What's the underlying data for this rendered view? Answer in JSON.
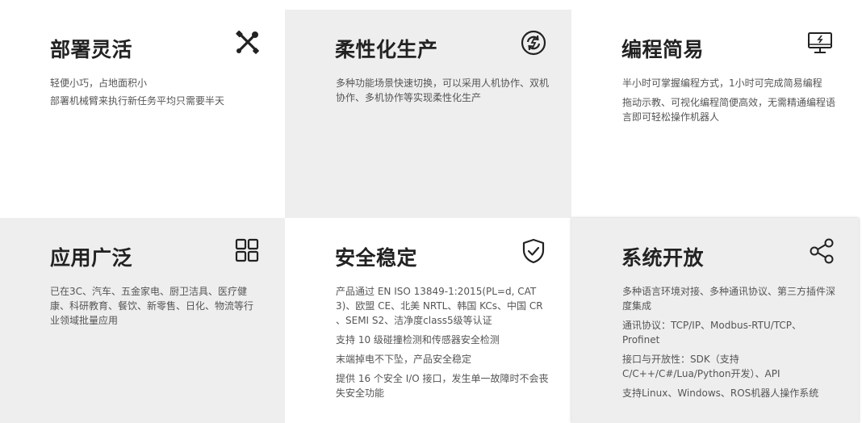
{
  "cards": [
    {
      "title": "部署灵活",
      "icon": "tools-icon",
      "lines": [
        "轻便小巧，占地面积小",
        "部署机械臂来执行新任务平均只需要半天"
      ]
    },
    {
      "title": "柔性化生产",
      "icon": "switch-icon",
      "lines": [
        "多种功能场景快速切换，可以采用人机协作、双机协作、多机协作等实现柔性化生产"
      ]
    },
    {
      "title": "编程简易",
      "icon": "monitor-icon",
      "lines": [
        "半小时可掌握编程方式，1小时可完成简易编程",
        "拖动示教、可视化编程简便高效，无需精通编程语言即可轻松操作机器人"
      ]
    },
    {
      "title": "应用广泛",
      "icon": "grid-icon",
      "lines": [
        "已在3C、汽车、五金家电、厨卫洁具、医疗健康、科研教育、餐饮、新零售、日化、物流等行业领域批量应用"
      ]
    },
    {
      "title": "安全稳定",
      "icon": "shield-check-icon",
      "lines": [
        "产品通过 EN ISO 13849-1:2015(PL=d, CAT 3)、欧盟 CE、北美 NRTL、韩国 KCs、中国 CR 、SEMI S2、洁净度class5级等认证",
        "支持 10 级碰撞检测和传感器安全检测",
        "末端掉电不下坠，产品安全稳定",
        "提供 16 个安全 I/O 接口，发生单一故障时不会丧失安全功能"
      ]
    },
    {
      "title": "系统开放",
      "icon": "share-icon",
      "lines": [
        "多种语言环境对接、多种通讯协议、第三方插件深度集成",
        "通讯协议：TCP/IP、Modbus-RTU/TCP、Profinet",
        "接口与开放性：SDK（支持C/C++/C#/Lua/Python开发）、API",
        "支持Linux、Windows、ROS机器人操作系统"
      ]
    }
  ]
}
